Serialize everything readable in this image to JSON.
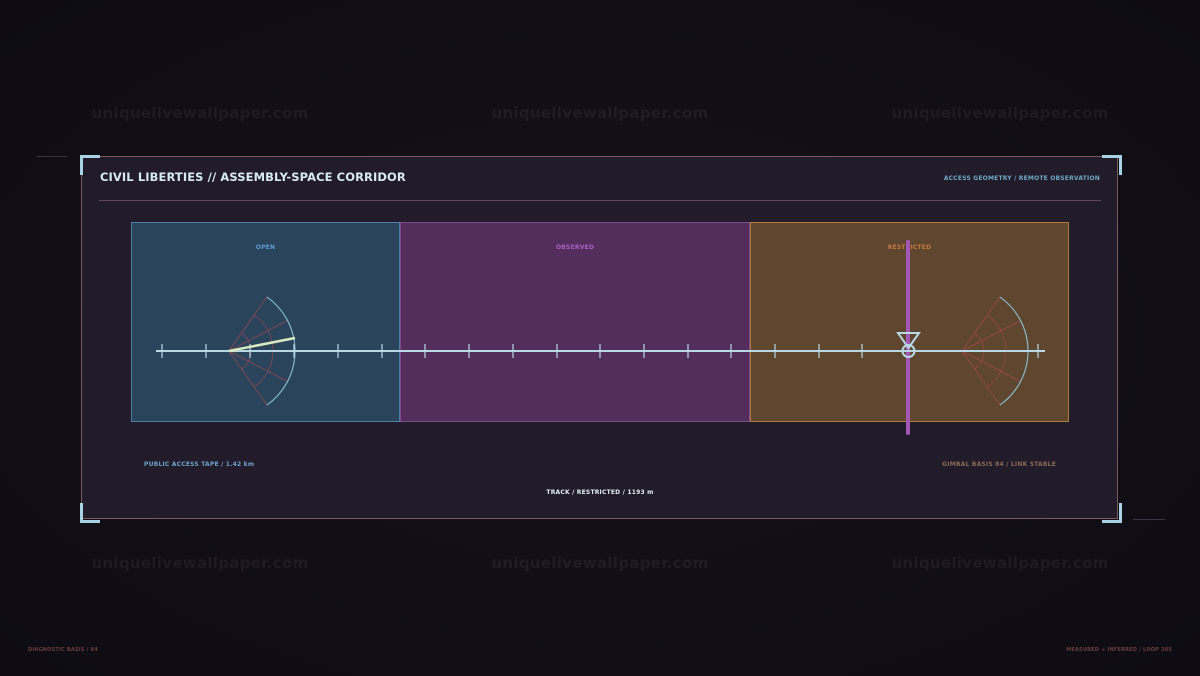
{
  "watermark": {
    "text": "uniquelivewallpaper.com"
  },
  "panel": {
    "title": "CIVIL LIBERTIES // ASSEMBLY-SPACE CORRIDOR",
    "subtitle": "ACCESS GEOMETRY / REMOTE OBSERVATION"
  },
  "zones": [
    {
      "label": "OPEN",
      "fill": "#2a445c",
      "border": "#4d7fa6",
      "label_color": "#5f9bd0"
    },
    {
      "label": "OBSERVED",
      "fill": "#532e5d",
      "border": "#7c4b8c",
      "label_color": "#a760c0"
    },
    {
      "label": "RESTRICTED",
      "fill": "#5f462f",
      "border": "#b07a3b",
      "label_color": "#c07a43"
    }
  ],
  "track": {
    "line_color": "#b8d8e6",
    "barrier_color": "#a356b4",
    "arc_color": "#8ec3d6",
    "ray_color": "#b24a52"
  },
  "captions": {
    "left": "PUBLIC ACCESS TAPE / 1.42 km",
    "center": "TRACK / RESTRICTED / 1193 m",
    "right": "GIMBAL BASIS 84 / LINK STABLE"
  },
  "footer": {
    "left": "DIAGNOSTIC BASIS / 84",
    "right": "MEASURED + INFERRED / LOOP 385"
  },
  "colors": {
    "background": "#110e16",
    "panel": "#221b29",
    "panel_border": "#7a5a5c",
    "accent": "#a7d2e2"
  }
}
